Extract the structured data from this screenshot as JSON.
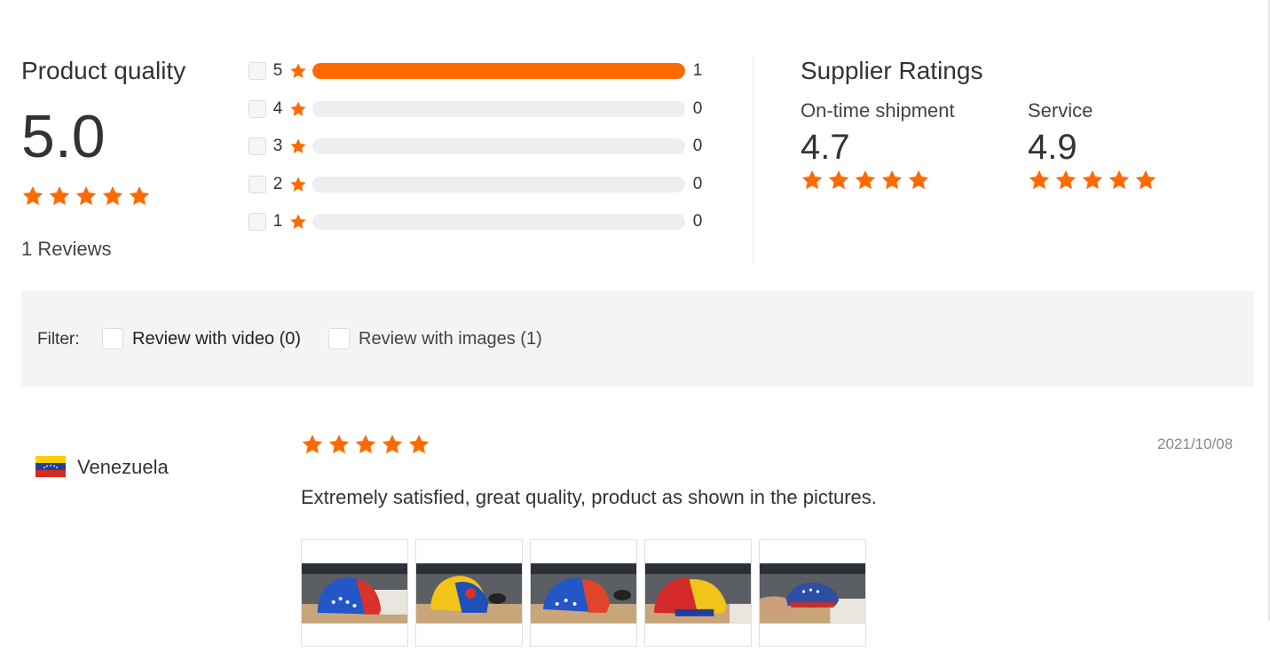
{
  "colors": {
    "accent": "#ff6a00",
    "track": "#eeeef1"
  },
  "product_quality": {
    "title": "Product quality",
    "score": "5.0",
    "stars": 5,
    "reviews_label": "1 Reviews",
    "distribution": [
      {
        "stars": "5",
        "count": "1",
        "fraction": 1.0
      },
      {
        "stars": "4",
        "count": "0",
        "fraction": 0
      },
      {
        "stars": "3",
        "count": "0",
        "fraction": 0
      },
      {
        "stars": "2",
        "count": "0",
        "fraction": 0
      },
      {
        "stars": "1",
        "count": "0",
        "fraction": 0
      }
    ]
  },
  "supplier_ratings": {
    "title": "Supplier Ratings",
    "items": [
      {
        "label": "On-time shipment",
        "score": "4.7",
        "stars": 5
      },
      {
        "label": "Service",
        "score": "4.9",
        "stars": 5
      }
    ]
  },
  "filter": {
    "label": "Filter:",
    "options": [
      {
        "label": "Review with video (0)",
        "checked": false
      },
      {
        "label": "Review with images (1)",
        "checked": false
      }
    ]
  },
  "review": {
    "country": "Venezuela",
    "flag_icon": "venezuela-flag-icon",
    "stars": 5,
    "date": "2021/10/08",
    "text": "Extremely satisfied, great quality, product as shown in the pictures.",
    "images": [
      {
        "icon": "cap-photo-blue-red"
      },
      {
        "icon": "cap-photo-yellow-blue"
      },
      {
        "icon": "cap-photo-blue-red"
      },
      {
        "icon": "cap-photo-red-yellow"
      },
      {
        "icon": "cap-photo-hand-blue"
      }
    ]
  }
}
